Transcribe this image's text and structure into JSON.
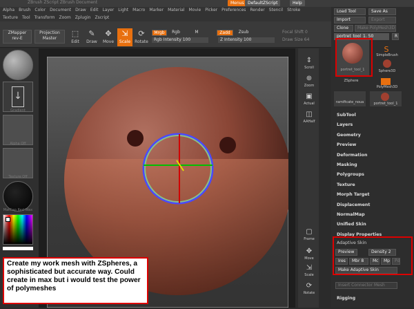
{
  "title_bar": {
    "title": "ZBrush  ZScript  ZBrush Document   ",
    "menus_btn": "Menus",
    "script_btn": "DefaultZScript",
    "help_btn": "Help"
  },
  "menu_row1": [
    "Alpha",
    "Brush",
    "Color",
    "Document",
    "Draw",
    "Edit",
    "Layer",
    "Light",
    "Macro",
    "Marker",
    "Material",
    "Movie",
    "Picker",
    "Preferences",
    "Render",
    "Stencil",
    "Stroke"
  ],
  "menu_row2": [
    "Texture",
    "Tool",
    "Transform",
    "Zoom",
    "Zplugin",
    "Zscript"
  ],
  "toolbar": {
    "zmapper": "ZMapper",
    "zmapper_sub": "rev-E",
    "projection": "Projection",
    "projection_sub": "Master",
    "edit": "Edit",
    "draw": "Draw",
    "move": "Move",
    "scale": "Scale",
    "rotate": "Rotate",
    "mrgb": "Mrgb",
    "rgb": "Rgb",
    "m": "M",
    "rgb_intensity": "Rgb Intensity 100",
    "zadd": "Zadd",
    "zsub": "Zsub",
    "z_intensity": "Z Intensity 100",
    "focal_shift": "Focal Shift 0",
    "draw_size": "Draw Size 64"
  },
  "left_tray": {
    "slot1": "",
    "slot2": "Gradient",
    "slot3": "Alpha Off",
    "slot4": "Texture Off",
    "slot5": "MatCap Red Wax"
  },
  "icon_col": [
    "Scroll",
    "Zoom",
    "Actual",
    "AAHalf",
    "Frame",
    "Move",
    "Scale",
    "Rotate"
  ],
  "rpanel": {
    "load_tool": "Load Tool",
    "save_as": "Save As",
    "import": "Import",
    "export": "Export",
    "clone": "Clone",
    "make_polymesh": "Make PolyMesh3D",
    "tool_name": "portret_tool_1. 50",
    "r": "R",
    "tool_thumb": "portret_tool_1",
    "simple_brush": "SimpleBrush",
    "sphere3d": "Sphere3D",
    "zsphere": "ZSphere",
    "polymesh3d": "PolyMesh3D",
    "ramificate": "ramificate_noua",
    "portret2": "portret_tool_1",
    "items": [
      "SubTool",
      "Layers",
      "Geometry",
      "Preview",
      "Deformation",
      "Masking",
      "Polygroups",
      "Texture",
      "Morph Target",
      "Displacement",
      "NormalMap",
      "Unified Skin",
      "Display Properties"
    ],
    "adaptive_title": "Adaptive Skin",
    "preview": "Preview",
    "density": "Density 2",
    "ires": "Ires",
    "mbr": "Mbr 8",
    "mc": "Mc",
    "mp": "Mp",
    "pd": "Pd",
    "make_adaptive": "Make Adaptive Skin",
    "insert_connector": "Insert Connector Mesh",
    "rigging": "Rigging"
  },
  "annotation": "Create my work mesh with ZSpheres, a sophisticated but accurate way. Could create in max but i would test the power of polymeshes",
  "colors": {
    "accent": "#e8700f",
    "highlight": "#d00000"
  }
}
